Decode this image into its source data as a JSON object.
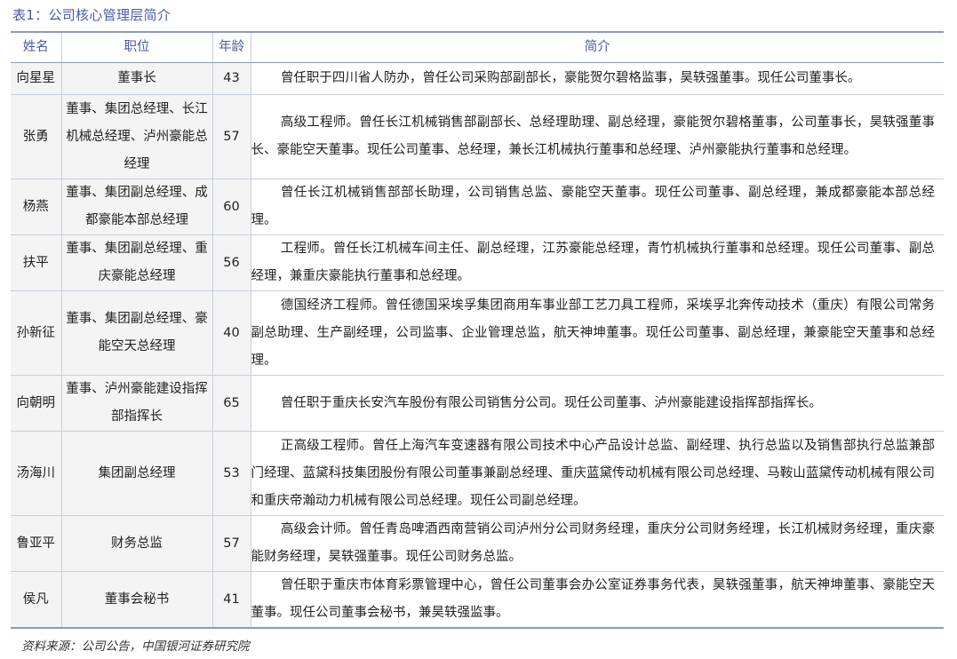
{
  "caption": "表1：公司核心管理层简介",
  "headers": {
    "name": "姓名",
    "title": "职位",
    "age": "年龄",
    "desc": "简介"
  },
  "rows": [
    {
      "name": "向星星",
      "title": "董事长",
      "age": "43",
      "desc": "曾任职于四川省人防办，曾任公司采购部副部长，豪能贺尔碧格监事，昊轶强董事。现任公司董事长。"
    },
    {
      "name": "张勇",
      "title": "董事、集团总经理、长江机械总经理、泸州豪能总经理",
      "age": "57",
      "desc": "高级工程师。曾任长江机械销售部副部长、总经理助理、副总经理，豪能贺尔碧格董事，公司董事长，昊轶强董事长、豪能空天董事。现任公司董事、总经理，兼长江机械执行董事和总经理、泸州豪能执行董事和总经理。"
    },
    {
      "name": "杨燕",
      "title": "董事、集团副总经理、成都豪能本部总经理",
      "age": "60",
      "desc": "曾任长江机械销售部部长助理，公司销售总监、豪能空天董事。现任公司董事、副总经理，兼成都豪能本部总经理。"
    },
    {
      "name": "扶平",
      "title": "董事、集团副总经理、重庆豪能总经理",
      "age": "56",
      "desc": "工程师。曾任长江机械车间主任、副总经理，江苏豪能总经理，青竹机械执行董事和总经理。现任公司董事、副总经理，兼重庆豪能执行董事和总经理。"
    },
    {
      "name": "孙新征",
      "title": "董事、集团副总经理、豪能空天总经理",
      "age": "40",
      "desc": "德国经济工程师。曾任德国采埃孚集团商用车事业部工艺刀具工程师，采埃孚北奔传动技术（重庆）有限公司常务副总助理、生产副经理，公司监事、企业管理总监，航天神坤董事。现任公司董事、副总经理，兼豪能空天董事和总经理。"
    },
    {
      "name": "向朝明",
      "title": "董事、泸州豪能建设指挥部指挥长",
      "age": "65",
      "desc": "曾任职于重庆长安汽车股份有限公司销售分公司。现任公司董事、泸州豪能建设指挥部指挥长。"
    },
    {
      "name": "汤海川",
      "title": "集团副总经理",
      "age": "53",
      "desc": "正高级工程师。曾任上海汽车变速器有限公司技术中心产品设计总监、副经理、执行总监以及销售部执行总监兼部门经理、蓝黛科技集团股份有限公司董事兼副总经理、重庆蓝黛传动机械有限公司总经理、马鞍山蓝黛传动机械有限公司和重庆帝瀚动力机械有限公司总经理。现任公司副总经理。"
    },
    {
      "name": "鲁亚平",
      "title": "财务总监",
      "age": "57",
      "desc": "高级会计师。曾任青岛啤酒西南营销公司泸州分公司财务经理，重庆分公司财务经理，长江机械财务经理，重庆豪能财务经理，昊轶强董事。现任公司财务总监。"
    },
    {
      "name": "侯凡",
      "title": "董事会秘书",
      "age": "41",
      "desc": "曾任职于重庆市体育彩票管理中心，曾任公司董事会办公室证券事务代表，昊轶强董事，航天神坤董事、豪能空天董事。现任公司董事会秘书，兼昊轶强监事。"
    }
  ],
  "source": "资料来源：公司公告，中国银河证券研究院"
}
